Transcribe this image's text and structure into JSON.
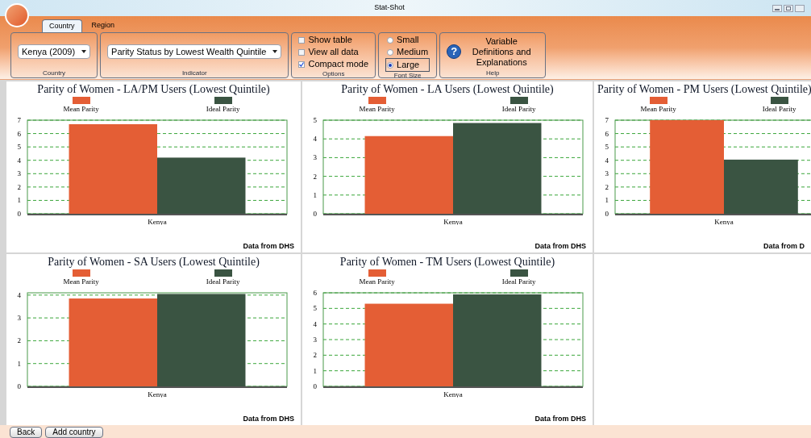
{
  "window": {
    "title": "Stat-Shot"
  },
  "ribbon_tabs": [
    {
      "label": "Country",
      "selected": true
    },
    {
      "label": "Region",
      "selected": false
    }
  ],
  "groups": [
    {
      "kind": "dropdown",
      "label": "Country",
      "value": "Kenya (2009)"
    },
    {
      "kind": "dropdown",
      "label": "Indicator",
      "value": "Parity Status by Lowest Wealth Quintile"
    },
    {
      "kind": "checkboxes",
      "label": "Options",
      "items": [
        {
          "label": "Show table",
          "checked": false
        },
        {
          "label": "View all data",
          "checked": false
        },
        {
          "label": "Compact mode",
          "checked": true
        }
      ]
    },
    {
      "kind": "radios",
      "label": "Font Size",
      "items": [
        {
          "label": "Small",
          "selected": false
        },
        {
          "label": "Medium",
          "selected": false
        },
        {
          "label": "Large",
          "selected": true
        }
      ]
    },
    {
      "kind": "help",
      "label": "Help",
      "icon": "?",
      "text": "Variable Definitions and Explanations"
    }
  ],
  "charts": [
    {
      "source": "Data from DHS",
      "chart_data": {
        "type": "bar",
        "title": "Parity of Women - LA/PM Users (Lowest Quintile)",
        "grid": true,
        "categories": [
          "Kenya"
        ],
        "ylim": [
          0,
          7
        ],
        "yticks": [
          0,
          1,
          2,
          3,
          4,
          5,
          6,
          7
        ],
        "series": [
          {
            "name": "Mean Parity",
            "color": "#e45e35",
            "values": [
              6.7
            ]
          },
          {
            "name": "Ideal Parity",
            "color": "#3a5442",
            "values": [
              4.2
            ]
          }
        ]
      }
    },
    {
      "source": "Data from DHS",
      "chart_data": {
        "type": "bar",
        "title": "Parity of Women - LA Users (Lowest Quintile)",
        "grid": true,
        "categories": [
          "Kenya"
        ],
        "ylim": [
          0,
          5
        ],
        "yticks": [
          0,
          1,
          2,
          3,
          4,
          5
        ],
        "series": [
          {
            "name": "Mean Parity",
            "color": "#e45e35",
            "values": [
              4.15
            ]
          },
          {
            "name": "Ideal Parity",
            "color": "#3a5442",
            "values": [
              4.85
            ]
          }
        ]
      }
    },
    {
      "source": "Data from D",
      "chart_data": {
        "type": "bar",
        "title": "Parity of Women - PM Users (Lowest Quintile)",
        "grid": true,
        "categories": [
          "Kenya"
        ],
        "ylim": [
          0,
          7
        ],
        "yticks": [
          0,
          1,
          2,
          3,
          4,
          5,
          6,
          7
        ],
        "series": [
          {
            "name": "Mean Parity",
            "color": "#e45e35",
            "values": [
              7.0
            ]
          },
          {
            "name": "Ideal Parity",
            "color": "#3a5442",
            "values": [
              4.05
            ]
          }
        ]
      }
    },
    {
      "source": "Data from DHS",
      "chart_data": {
        "type": "bar",
        "title": "Parity of Women - SA Users (Lowest Quintile)",
        "grid": true,
        "categories": [
          "Kenya"
        ],
        "ylim": [
          0,
          4.1
        ],
        "yticks": [
          0,
          1,
          2,
          3,
          4
        ],
        "series": [
          {
            "name": "Mean Parity",
            "color": "#e45e35",
            "values": [
              3.85
            ]
          },
          {
            "name": "Ideal Parity",
            "color": "#3a5442",
            "values": [
              4.05
            ]
          }
        ]
      }
    },
    {
      "source": "Data from DHS",
      "chart_data": {
        "type": "bar",
        "title": "Parity of Women - TM Users (Lowest Quintile)",
        "grid": true,
        "categories": [
          "Kenya"
        ],
        "ylim": [
          0,
          6
        ],
        "yticks": [
          0,
          1,
          2,
          3,
          4,
          5,
          6
        ],
        "series": [
          {
            "name": "Mean Parity",
            "color": "#e45e35",
            "values": [
              5.3
            ]
          },
          {
            "name": "Ideal Parity",
            "color": "#3a5442",
            "values": [
              5.9
            ]
          }
        ]
      }
    }
  ],
  "footer_buttons": [
    "Back",
    "Add country"
  ]
}
